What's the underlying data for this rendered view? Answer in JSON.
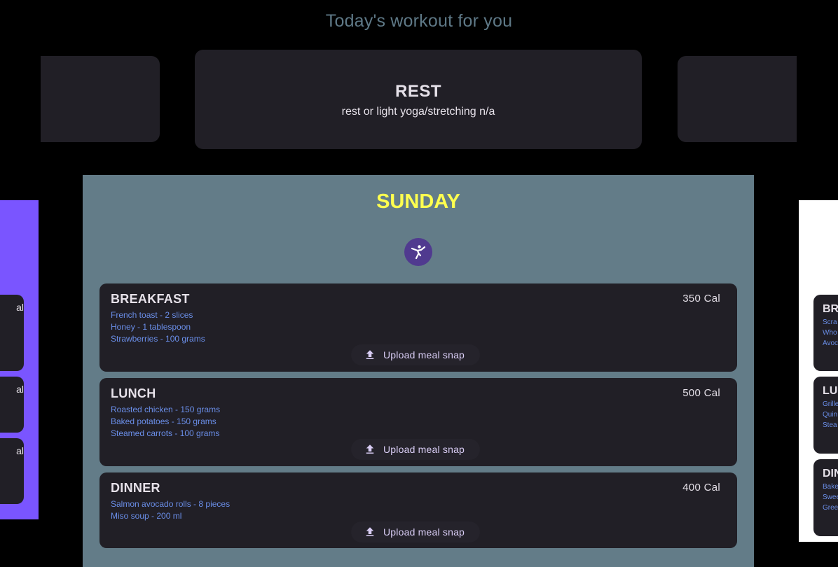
{
  "header": {
    "title": "Today's workout for you"
  },
  "workout": {
    "title": "REST",
    "subtitle": "rest or light yoga/stretching n/a"
  },
  "day": {
    "title": "SUNDAY",
    "activity_icon": "yoga-pose-icon",
    "meals": [
      {
        "title": "BREAKFAST",
        "calories": "350 Cal",
        "items": [
          "French toast - 2 slices",
          "Honey - 1 tablespoon",
          "Strawberries - 100 grams"
        ],
        "upload_label": "Upload meal snap"
      },
      {
        "title": "LUNCH",
        "calories": "500 Cal",
        "items": [
          "Roasted chicken - 150 grams",
          "Baked potatoes - 150 grams",
          "Steamed carrots - 100 grams"
        ],
        "upload_label": "Upload meal snap"
      },
      {
        "title": "DINNER",
        "calories": "400 Cal",
        "items": [
          "Salmon avocado rolls - 8 pieces",
          "Miso soup - 200 ml"
        ],
        "upload_label": "Upload meal snap"
      }
    ]
  },
  "prev_day": {
    "calorie_fragments": [
      "al",
      "al",
      "al"
    ]
  },
  "next_day": {
    "meals": [
      {
        "title": "BR",
        "items": [
          "Scra",
          "Who",
          "Avoc"
        ]
      },
      {
        "title": "LU",
        "items": [
          "Grille",
          "Quin",
          "Stea"
        ]
      },
      {
        "title": "DIN",
        "items": [
          "Bake",
          "Swee",
          "Gree"
        ]
      }
    ]
  },
  "colors": {
    "background": "#000000",
    "card": "#211f26",
    "day_card": "#637c88",
    "day_title": "#ffff4f",
    "item_text": "#6a8ee8",
    "accent": "#503a8f",
    "prev_day_bg": "#7a55ff",
    "next_day_bg": "#ffffff"
  }
}
